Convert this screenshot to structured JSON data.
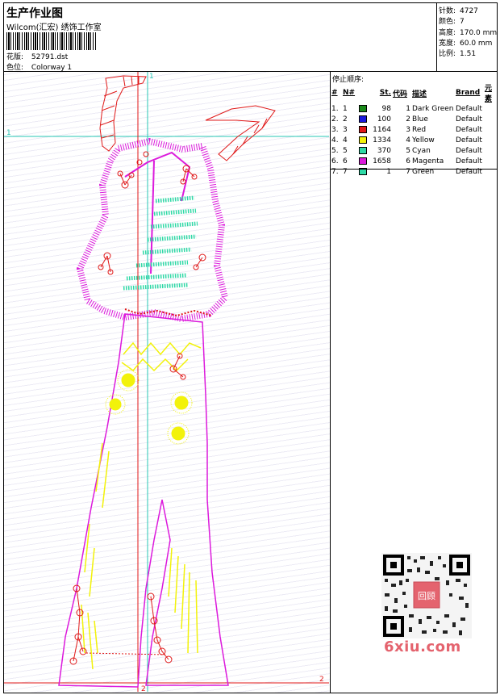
{
  "header": {
    "title": "生产作业图",
    "company": "Wilcom(汇宏) 绣饰工作室",
    "design_label": "花版:",
    "design_file": "52791.dst",
    "colorway_label": "色位:",
    "colorway": "Colorway 1"
  },
  "stats": [
    {
      "label": "针数:",
      "value": "4727"
    },
    {
      "label": "颜色:",
      "value": "7"
    },
    {
      "label": "高度:",
      "value": "170.0 mm"
    },
    {
      "label": "宽度:",
      "value": "60.0 mm"
    },
    {
      "label": "比例:",
      "value": "1.51"
    }
  ],
  "stop_sequence": {
    "title": "停止顺序:",
    "columns": [
      "#",
      "N#",
      "St.",
      "代码",
      "描述",
      "Brand",
      "元素"
    ],
    "rows": [
      {
        "idx": "1.",
        "n": "1",
        "color": "#1a8a1a",
        "st": "98",
        "code": "1",
        "desc": "Dark Green",
        "brand": "Default"
      },
      {
        "idx": "2.",
        "n": "2",
        "color": "#1a1adc",
        "st": "100",
        "code": "2",
        "desc": "Blue",
        "brand": "Default"
      },
      {
        "idx": "3.",
        "n": "3",
        "color": "#e01818",
        "st": "1164",
        "code": "3",
        "desc": "Red",
        "brand": "Default"
      },
      {
        "idx": "4.",
        "n": "4",
        "color": "#f2f20a",
        "st": "1334",
        "code": "4",
        "desc": "Yellow",
        "brand": "Default"
      },
      {
        "idx": "5.",
        "n": "5",
        "color": "#2fd9a6",
        "st": "370",
        "code": "5",
        "desc": "Cyan",
        "brand": "Default"
      },
      {
        "idx": "6.",
        "n": "6",
        "color": "#dc1adc",
        "st": "1658",
        "code": "6",
        "desc": "Magenta",
        "brand": "Default"
      },
      {
        "idx": "7.",
        "n": "7",
        "color": "#2fd9a6",
        "st": "1",
        "code": "7",
        "desc": "Green",
        "brand": "Default"
      }
    ]
  },
  "markers": {
    "frame_start": "1",
    "frame_end": "2"
  },
  "watermark": "6xiu.com",
  "qr_badge": "回顾"
}
